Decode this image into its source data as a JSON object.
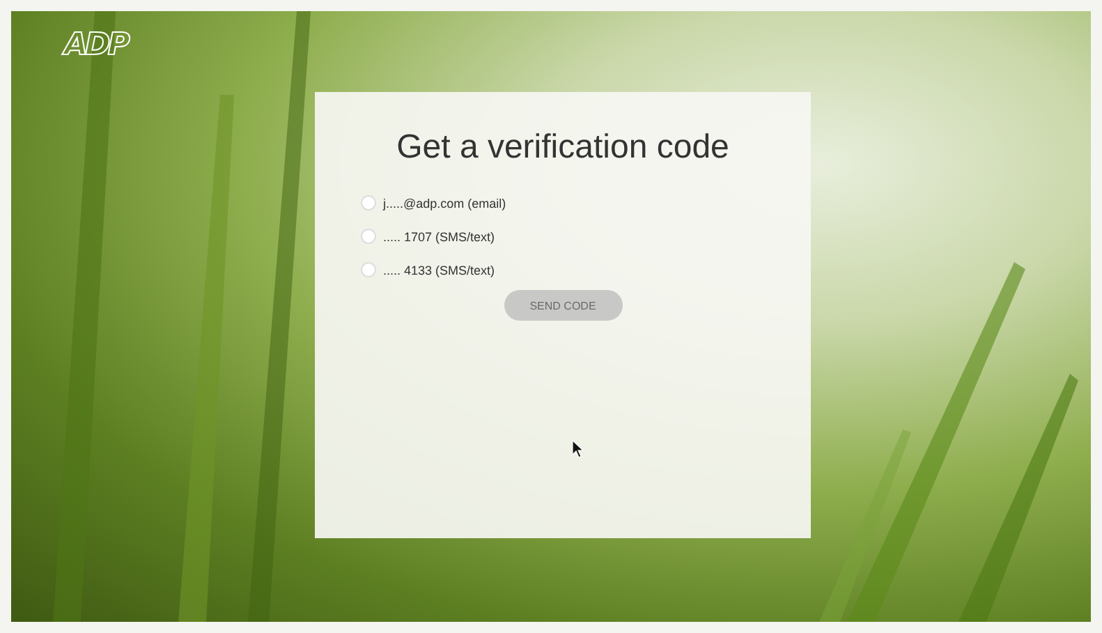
{
  "logo": {
    "text": "ADP"
  },
  "dialog": {
    "title": "Get a verification code",
    "options": [
      {
        "label": "j.....@adp.com (email)",
        "selected": false
      },
      {
        "label": "..... 1707 (SMS/text)",
        "selected": false
      },
      {
        "label": "..... 4133 (SMS/text)",
        "selected": false
      }
    ],
    "button": {
      "label": "SEND CODE",
      "disabled": true
    }
  }
}
